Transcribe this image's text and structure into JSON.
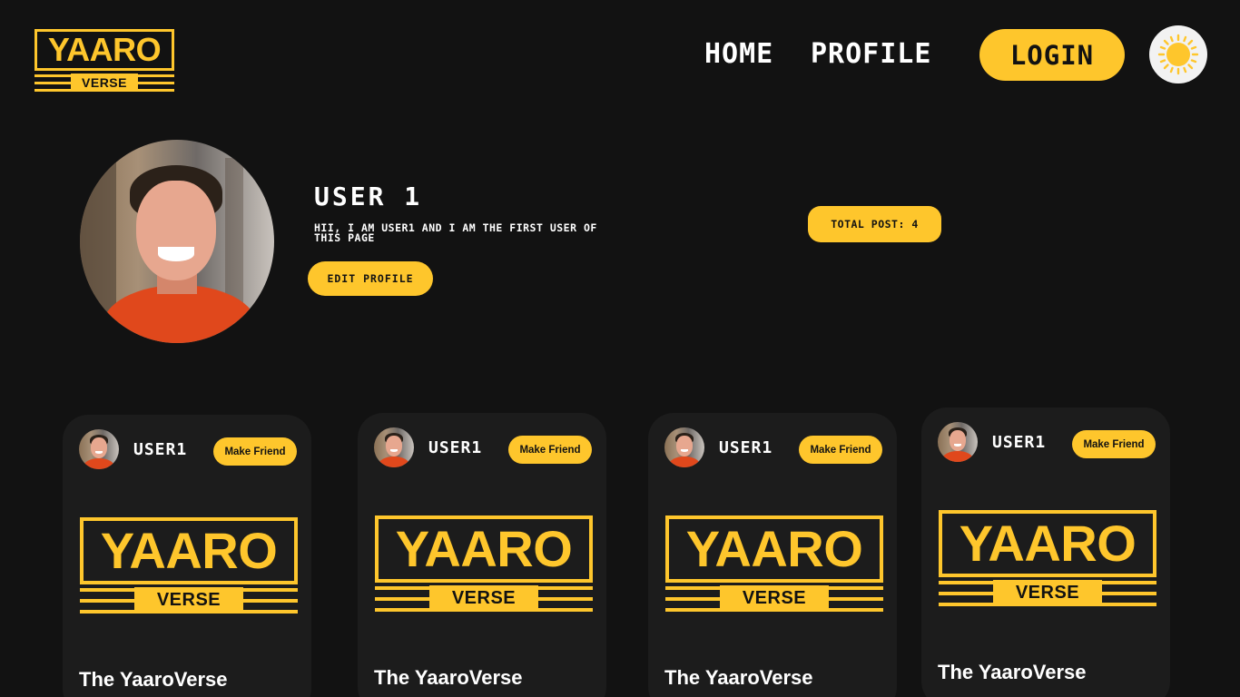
{
  "header": {
    "logo": {
      "main": "YAARO",
      "sub": "VERSE"
    },
    "nav": {
      "home": "HOME",
      "profile": "PROFILE",
      "login": "LOGIN"
    },
    "theme_icon": "sun-icon"
  },
  "profile": {
    "name": "USER 1",
    "bio": "Hii, i am user1 and i am the first user of this page",
    "edit_label": "EDIT PROFILE",
    "total_posts": "TOTAL POST: 4"
  },
  "posts": [
    {
      "user": "USER1",
      "action": "Make Friend",
      "logo_main": "YAARO",
      "logo_sub": "VERSE",
      "caption": "The YaaroVerse"
    },
    {
      "user": "USER1",
      "action": "Make Friend",
      "logo_main": "YAARO",
      "logo_sub": "VERSE",
      "caption": "The YaaroVerse"
    },
    {
      "user": "USER1",
      "action": "Make Friend",
      "logo_main": "YAARO",
      "logo_sub": "VERSE",
      "caption": "The YaaroVerse"
    },
    {
      "user": "USER1",
      "action": "Make Friend",
      "logo_main": "YAARO",
      "logo_sub": "VERSE",
      "caption": "The YaaroVerse"
    }
  ],
  "colors": {
    "accent": "#fec62c",
    "background": "#121212",
    "card": "#1c1c1c"
  }
}
